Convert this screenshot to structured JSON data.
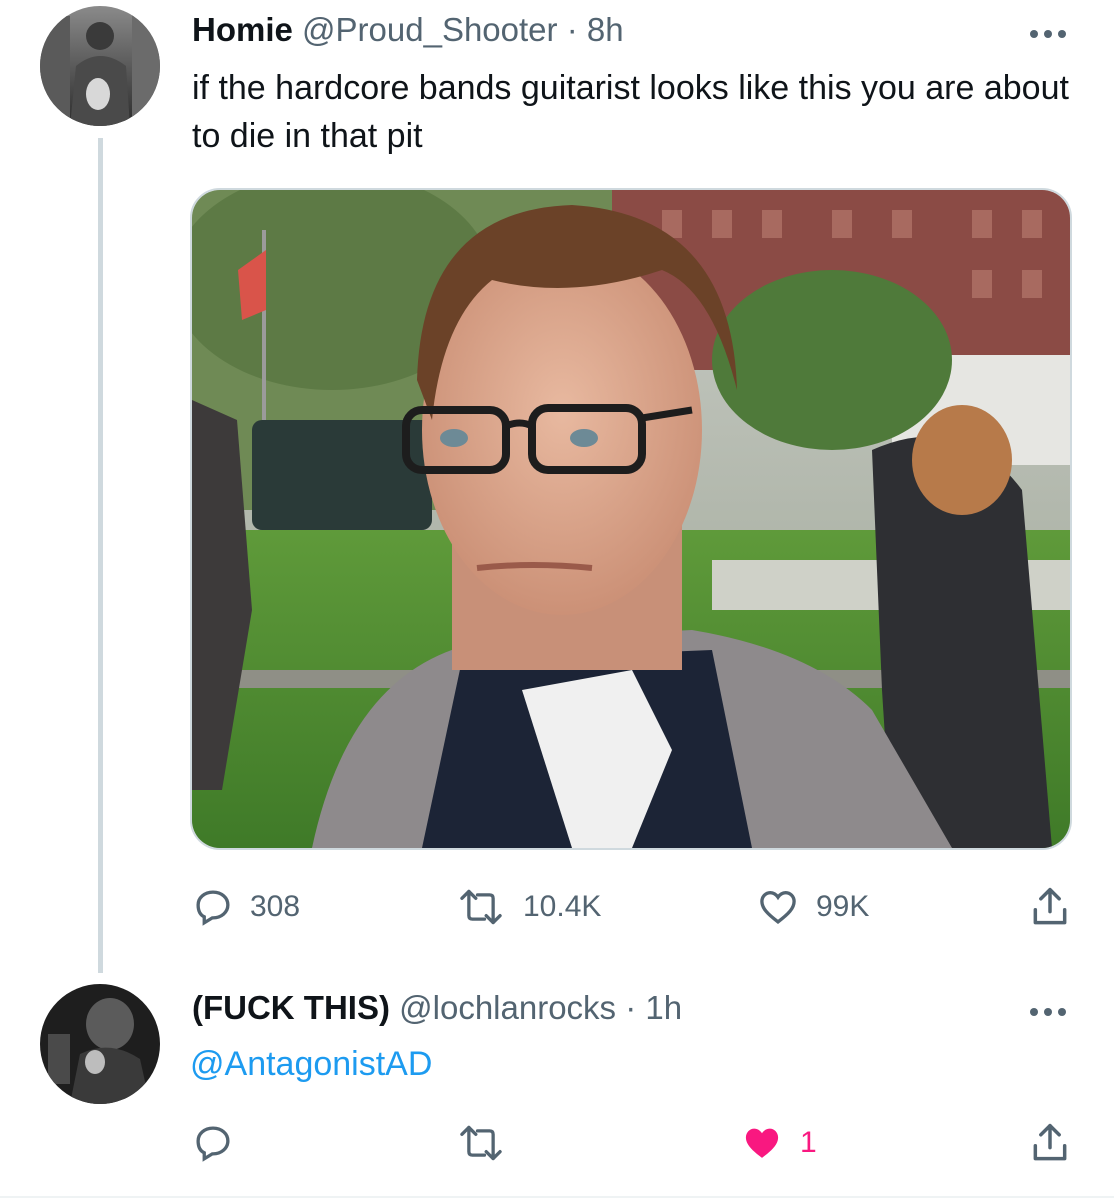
{
  "tweet": {
    "display_name": "Homie",
    "handle": "@Proud_Shooter",
    "separator": "·",
    "time": "8h",
    "text": "if the hardcore bands guitarist looks like this you are about to die in that pit",
    "avatar_icon": "user-avatar-photo",
    "media_alt_icon": "gif-photo",
    "actions": {
      "replies": "308",
      "retweets": "10.4K",
      "likes": "99K"
    }
  },
  "reply": {
    "display_name": "(FUCK THIS)",
    "handle": "@lochlanrocks",
    "separator": "·",
    "time": "1h",
    "text": "@AntagonistAD",
    "avatar_icon": "user-avatar-photo",
    "actions": {
      "replies": "",
      "retweets": "",
      "likes": "1",
      "liked": true
    }
  },
  "colors": {
    "text": "#0f1419",
    "muted": "#536471",
    "link": "#1d9bf0",
    "like": "#f91880",
    "thread_line": "#cfd9de"
  }
}
